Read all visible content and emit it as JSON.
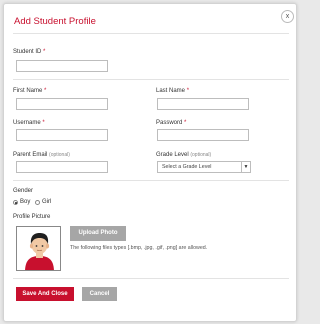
{
  "modal": {
    "title": "Add Student Profile",
    "close_symbol": "x"
  },
  "fields": {
    "student_id": {
      "label": "Student ID",
      "required": "*",
      "value": ""
    },
    "first_name": {
      "label": "First Name",
      "required": "*",
      "value": ""
    },
    "last_name": {
      "label": "Last Name",
      "required": "*",
      "value": ""
    },
    "username": {
      "label": "Username",
      "required": "*",
      "value": ""
    },
    "password": {
      "label": "Password",
      "required": "*",
      "value": ""
    },
    "parent_email": {
      "label": "Parent Email",
      "optional": "(optional)",
      "value": ""
    },
    "grade_level": {
      "label": "Grade Level",
      "optional": "(optional)",
      "selected": "Select a Grade Level"
    }
  },
  "gender": {
    "label": "Gender",
    "options": [
      {
        "label": "Boy",
        "checked": true
      },
      {
        "label": "Girl",
        "checked": false
      }
    ]
  },
  "profile_picture": {
    "label": "Profile Picture",
    "upload_label": "Upload Photo",
    "note": "The following files types [.bmp, .jpg, .gif, .png] are allowed."
  },
  "actions": {
    "save_label": "Save And Close",
    "cancel_label": "Cancel"
  },
  "colors": {
    "accent": "#c8102e",
    "secondary_button": "#a6a6a6"
  },
  "icons": {
    "close": "close-icon",
    "avatar": "student-avatar-icon",
    "select_arrow": "chevron-down-icon"
  }
}
